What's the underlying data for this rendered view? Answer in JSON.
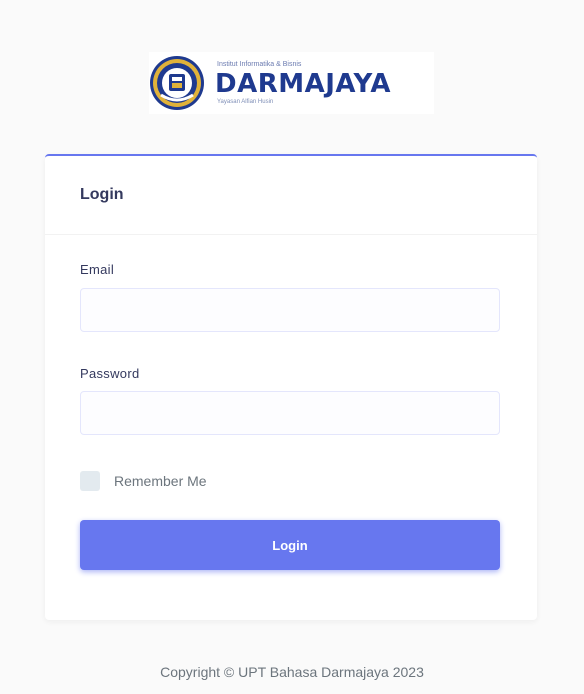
{
  "logo": {
    "institute": "Institut Informatika & Bisnis",
    "brand": "DARMAJAYA",
    "foundation": "Yayasan Alfian Husin",
    "seal_text": "DARMAJAYA",
    "colors": {
      "brand": "#1f3a8f",
      "seal_gold": "#e0b23a"
    }
  },
  "login_card": {
    "title": "Login",
    "email": {
      "label": "Email",
      "value": "",
      "placeholder": ""
    },
    "password": {
      "label": "Password",
      "value": "",
      "placeholder": ""
    },
    "remember": {
      "label": "Remember Me",
      "checked": false
    },
    "submit_label": "Login",
    "accent_color": "#6777ef"
  },
  "footer": {
    "text": "Copyright © UPT Bahasa Darmajaya 2023"
  }
}
